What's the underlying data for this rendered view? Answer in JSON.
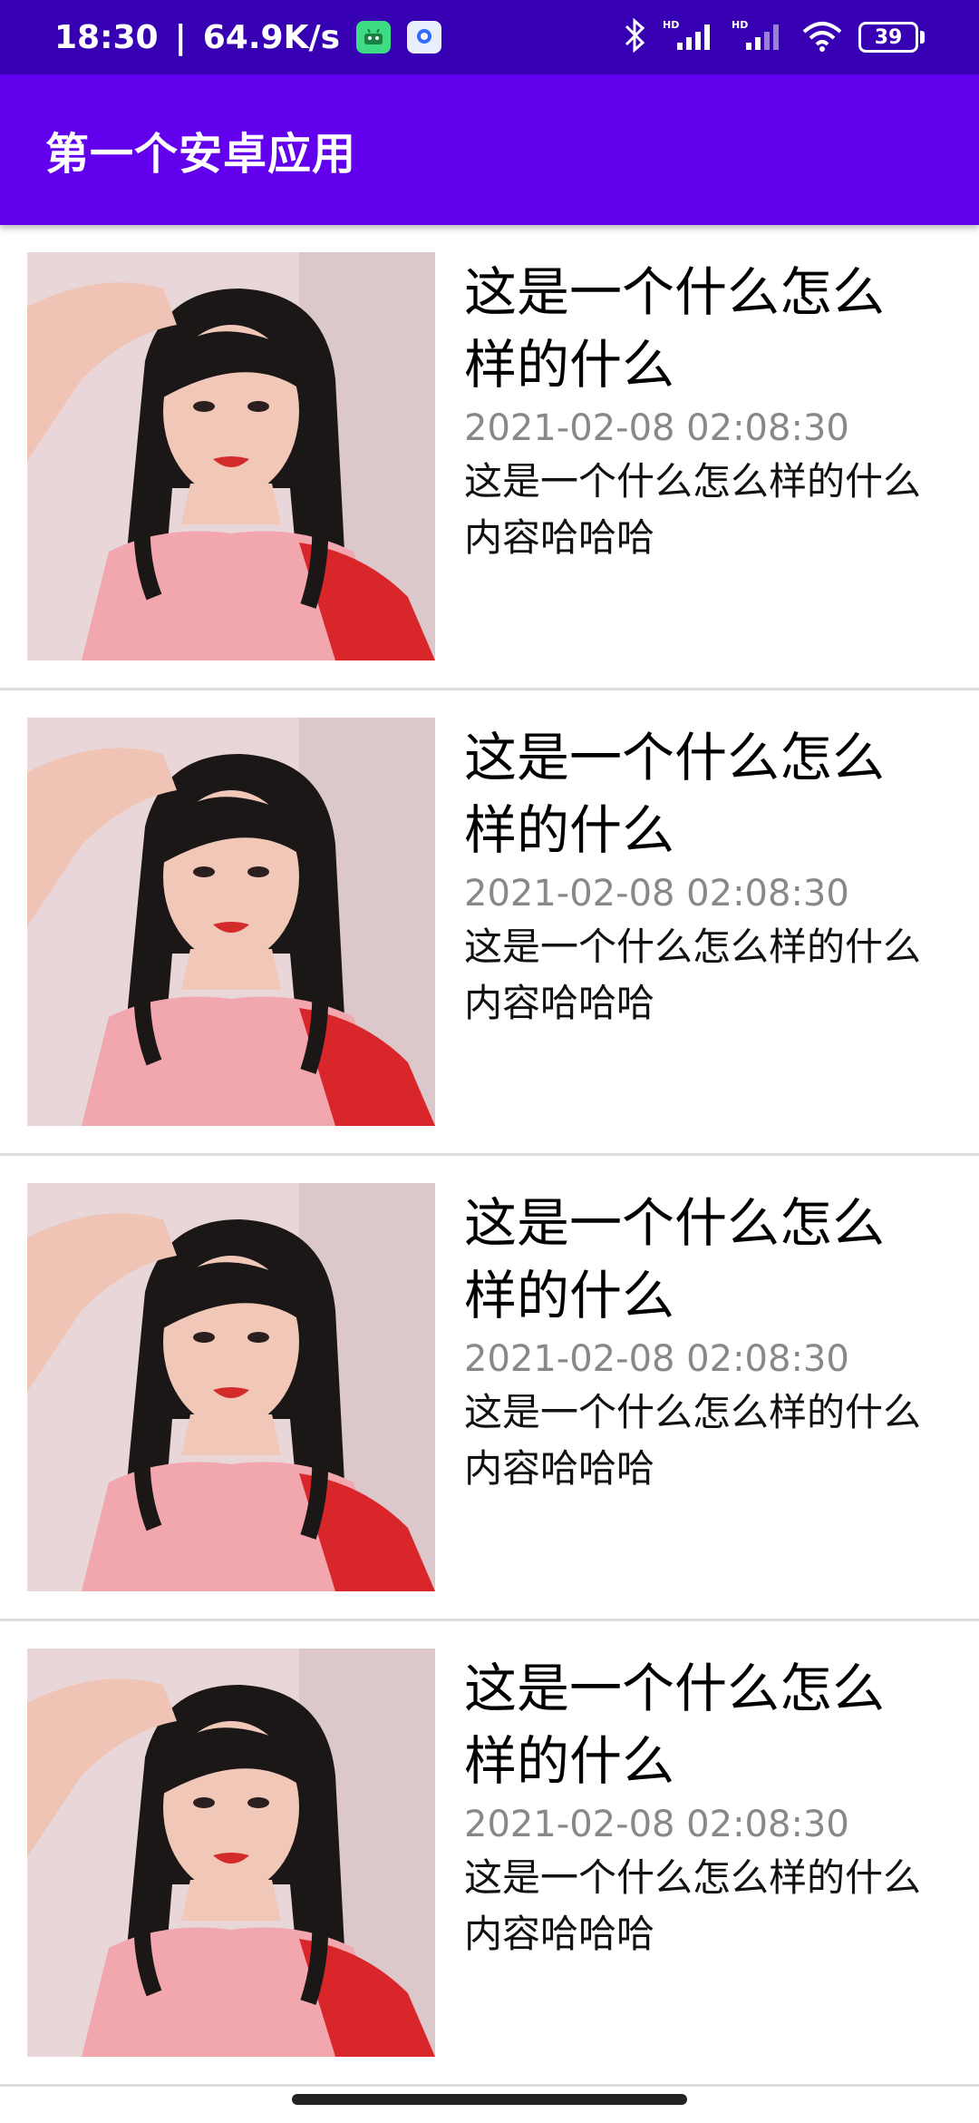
{
  "status_bar": {
    "time": "18:30",
    "net_speed": "64.9K/s",
    "battery": "39",
    "icons": [
      "android-app-icon",
      "app-store-icon",
      "bluetooth-icon",
      "signal-hd-icon",
      "signal-hd-icon",
      "wifi-icon",
      "battery-icon"
    ]
  },
  "app_bar": {
    "title": "第一个安卓应用"
  },
  "list": {
    "items": [
      {
        "title": "这是一个什么怎么样的什么",
        "date": "2021-02-08 02:08:30",
        "content": "这是一个什么怎么样的什么内容哈哈哈"
      },
      {
        "title": "这是一个什么怎么样的什么",
        "date": "2021-02-08 02:08:30",
        "content": "这是一个什么怎么样的什么内容哈哈哈"
      },
      {
        "title": "这是一个什么怎么样的什么",
        "date": "2021-02-08 02:08:30",
        "content": "这是一个什么怎么样的什么内容哈哈哈"
      },
      {
        "title": "这是一个什么怎么样的什么",
        "date": "2021-02-08 02:08:30",
        "content": "这是一个什么怎么样的什么内容哈哈哈"
      }
    ]
  },
  "colors": {
    "status_bar": "#3700b3",
    "app_bar": "#6200ee"
  }
}
